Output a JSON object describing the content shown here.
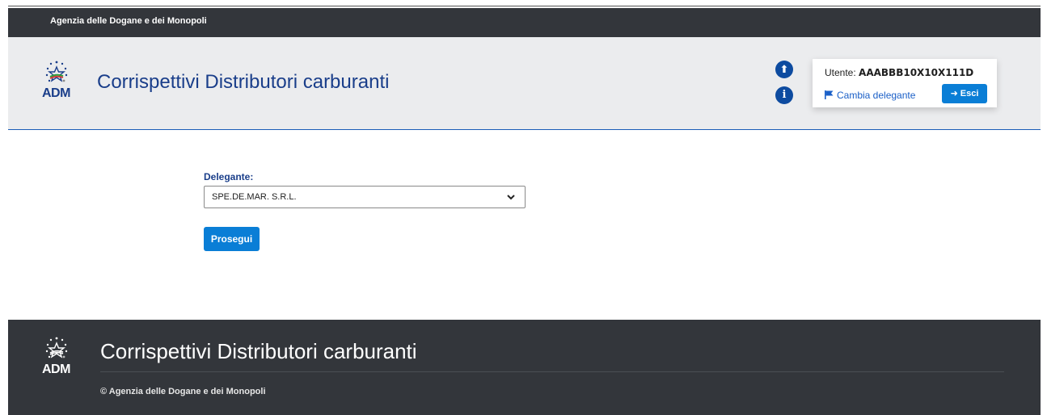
{
  "topbar": {
    "agency_name": "Agenzia delle Dogane e dei Monopoli"
  },
  "header": {
    "logo_text": "ADM",
    "app_title": "Corrispettivi Distributori carburanti",
    "upload_icon": "upload-circle-icon",
    "info_icon": "info-circle-icon",
    "upload_glyph": "⬆",
    "info_glyph": "i"
  },
  "user": {
    "label": "Utente:",
    "id": "AAABBB10X10X111D",
    "change_delegate_label": "Cambia delegante",
    "change_delegate_icon": "flag-icon",
    "exit_label": "Esci",
    "exit_icon": "sign-in-icon",
    "exit_glyph": "➜"
  },
  "form": {
    "delegate_label": "Delegante:",
    "delegate_selected": "SPE.DE.MAR. S.R.L.",
    "proceed_label": "Prosegui"
  },
  "footer": {
    "logo_text": "ADM",
    "title": "Corrispettivi Distributori carburanti",
    "copyright": "© Agenzia delle Dogane e dei Monopoli"
  },
  "colors": {
    "topbar": "#33363b",
    "header_bg": "#ebecee",
    "brand_blue": "#1a3e8a",
    "button_blue": "#0a7ed6",
    "link_blue": "#1a5fc7",
    "footer_bg": "#33363b"
  }
}
